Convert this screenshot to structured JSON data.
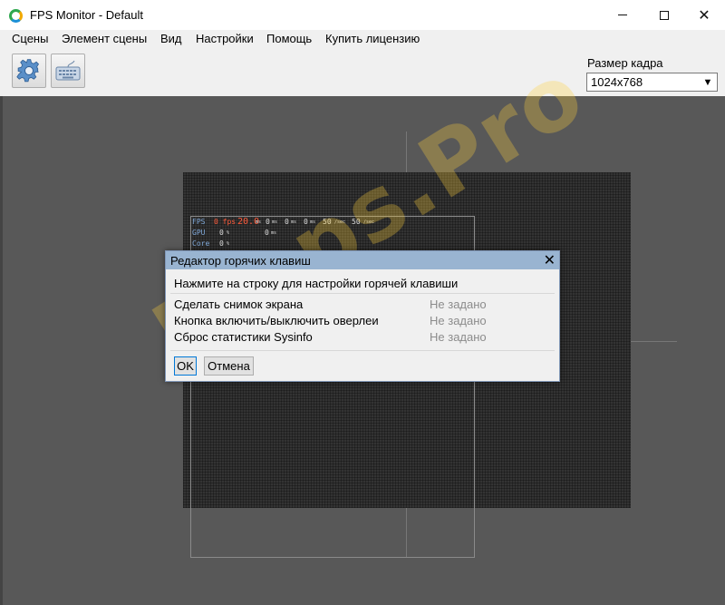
{
  "window": {
    "title": "FPS Monitor - Default",
    "minimize_icon": "minimize-icon",
    "maximize_icon": "maximize-icon",
    "close_glyph": "✕"
  },
  "menu": {
    "items": [
      "Сцены",
      "Элемент сцены",
      "Вид",
      "Настройки",
      "Помощь",
      "Купить лицензию"
    ]
  },
  "toolbar": {
    "settings_icon": "gear-icon",
    "hotkeys_icon": "keyboard-icon",
    "frame_size_label": "Размер кадра",
    "frame_size_value": "1024x768",
    "frame_size_arrow": "▼"
  },
  "osd": {
    "rows": [
      {
        "label": "FPS",
        "values": [
          "0 fps",
          "20.0",
          "ms",
          "0",
          "ms",
          "0",
          "ms",
          "0",
          "ms",
          "50",
          "/sec",
          "50",
          "/sec"
        ]
      },
      {
        "label": "GPU",
        "values": [
          "0",
          "%",
          "0",
          "ms"
        ]
      },
      {
        "label": "Core",
        "values": [
          "0",
          "%"
        ]
      }
    ]
  },
  "watermark": "Fraps.Pro",
  "dialog": {
    "title": "Редактор горячих клавиш",
    "close_glyph": "✕",
    "hint": "Нажмите на строку для настройки горячей клавиши",
    "hotkeys": [
      {
        "name": "Сделать снимок экрана",
        "value": "Не задано"
      },
      {
        "name": "Кнопка включить/выключить оверлеи",
        "value": "Не задано"
      },
      {
        "name": "Сброс статистики Sysinfo",
        "value": "Не задано"
      }
    ],
    "ok_label": "OK",
    "cancel_label": "Отмена"
  },
  "colors": {
    "accent": "#0078d7",
    "dialog_title_bg": "#99b4d1",
    "canvas_bg": "#585858",
    "osd_red": "#ff5a3a",
    "watermark": "#ffd23c"
  }
}
